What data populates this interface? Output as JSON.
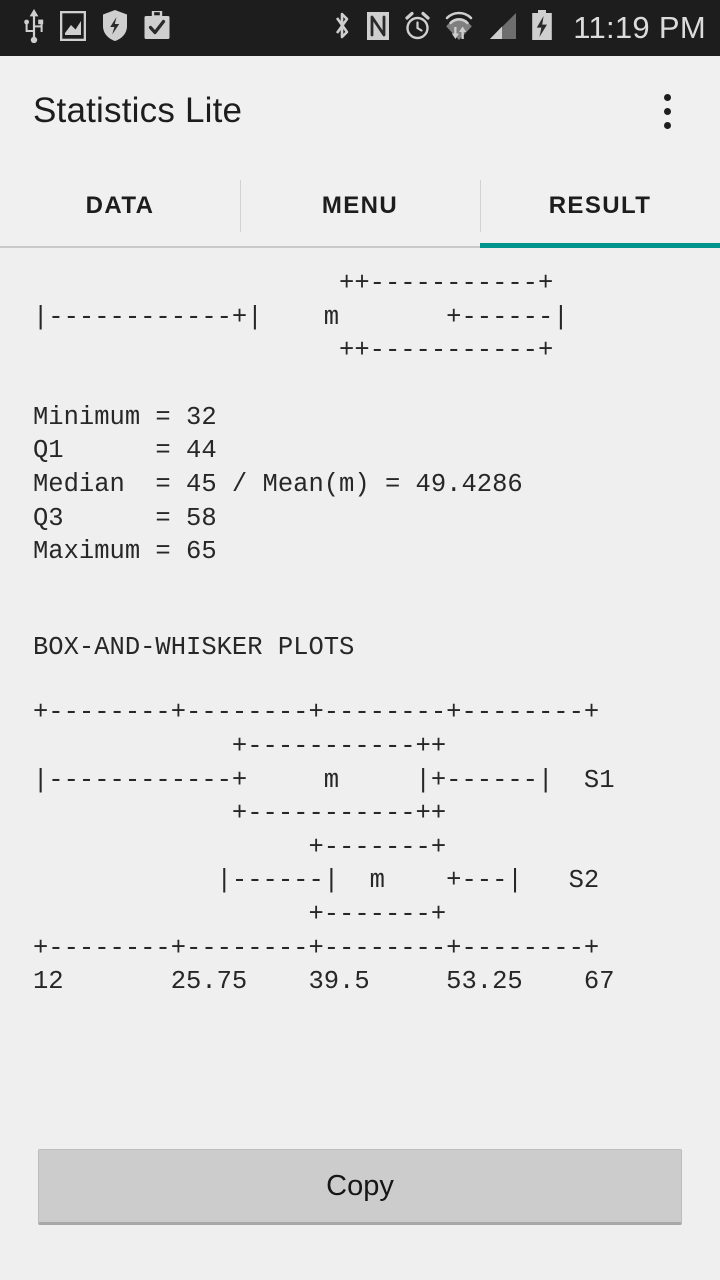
{
  "statusbar": {
    "time": "11:19 PM",
    "left_icons": [
      "usb-icon",
      "screenshot-image-icon",
      "shield-security-icon",
      "briefcase-check-icon"
    ],
    "right_icons": [
      "bluetooth-icon",
      "nfc-icon",
      "alarm-clock-icon",
      "wifi-transfer-icon",
      "cellular-signal-icon",
      "battery-charging-icon"
    ],
    "icon_color": "#cfcfcf",
    "background": "#1d1d1d"
  },
  "actionbar": {
    "title": "Statistics Lite",
    "overflow_label": "More options"
  },
  "tabs": {
    "items": [
      {
        "label": "DATA",
        "active": false
      },
      {
        "label": "MENU",
        "active": false
      },
      {
        "label": "RESULT",
        "active": true
      }
    ],
    "active_index": 2,
    "accent_color": "#00958c"
  },
  "result": {
    "single_plot": [
      "                    ++-----------+",
      "|------------+|    m       +------|",
      "                    ++-----------+"
    ],
    "stats": [
      "Minimum = 32",
      "Q1      = 44",
      "Median  = 45 / Mean(m) = 49.4286",
      "Q3      = 58",
      "Maximum = 65"
    ],
    "section_title": "BOX-AND-WHISKER PLOTS",
    "comparison_plot": [
      "+--------+--------+--------+--------+",
      "             +-----------++",
      "|------------+     m     |+------|  S1",
      "             +-----------++",
      "                  +-------+",
      "            |------|  m    +---|   S2",
      "                  +-------+",
      "+--------+--------+--------+--------+",
      "12       25.75    39.5     53.25    67"
    ],
    "summary_values": {
      "minimum": 32,
      "q1": 44,
      "median": 45,
      "mean": 49.4286,
      "q3": 58,
      "maximum": 65
    },
    "axis_ticks": [
      "12",
      "25.75",
      "39.5",
      "53.25",
      "67"
    ],
    "series_labels": [
      "S1",
      "S2"
    ],
    "text_color": "#272727"
  },
  "footer": {
    "copy_label": "Copy"
  }
}
